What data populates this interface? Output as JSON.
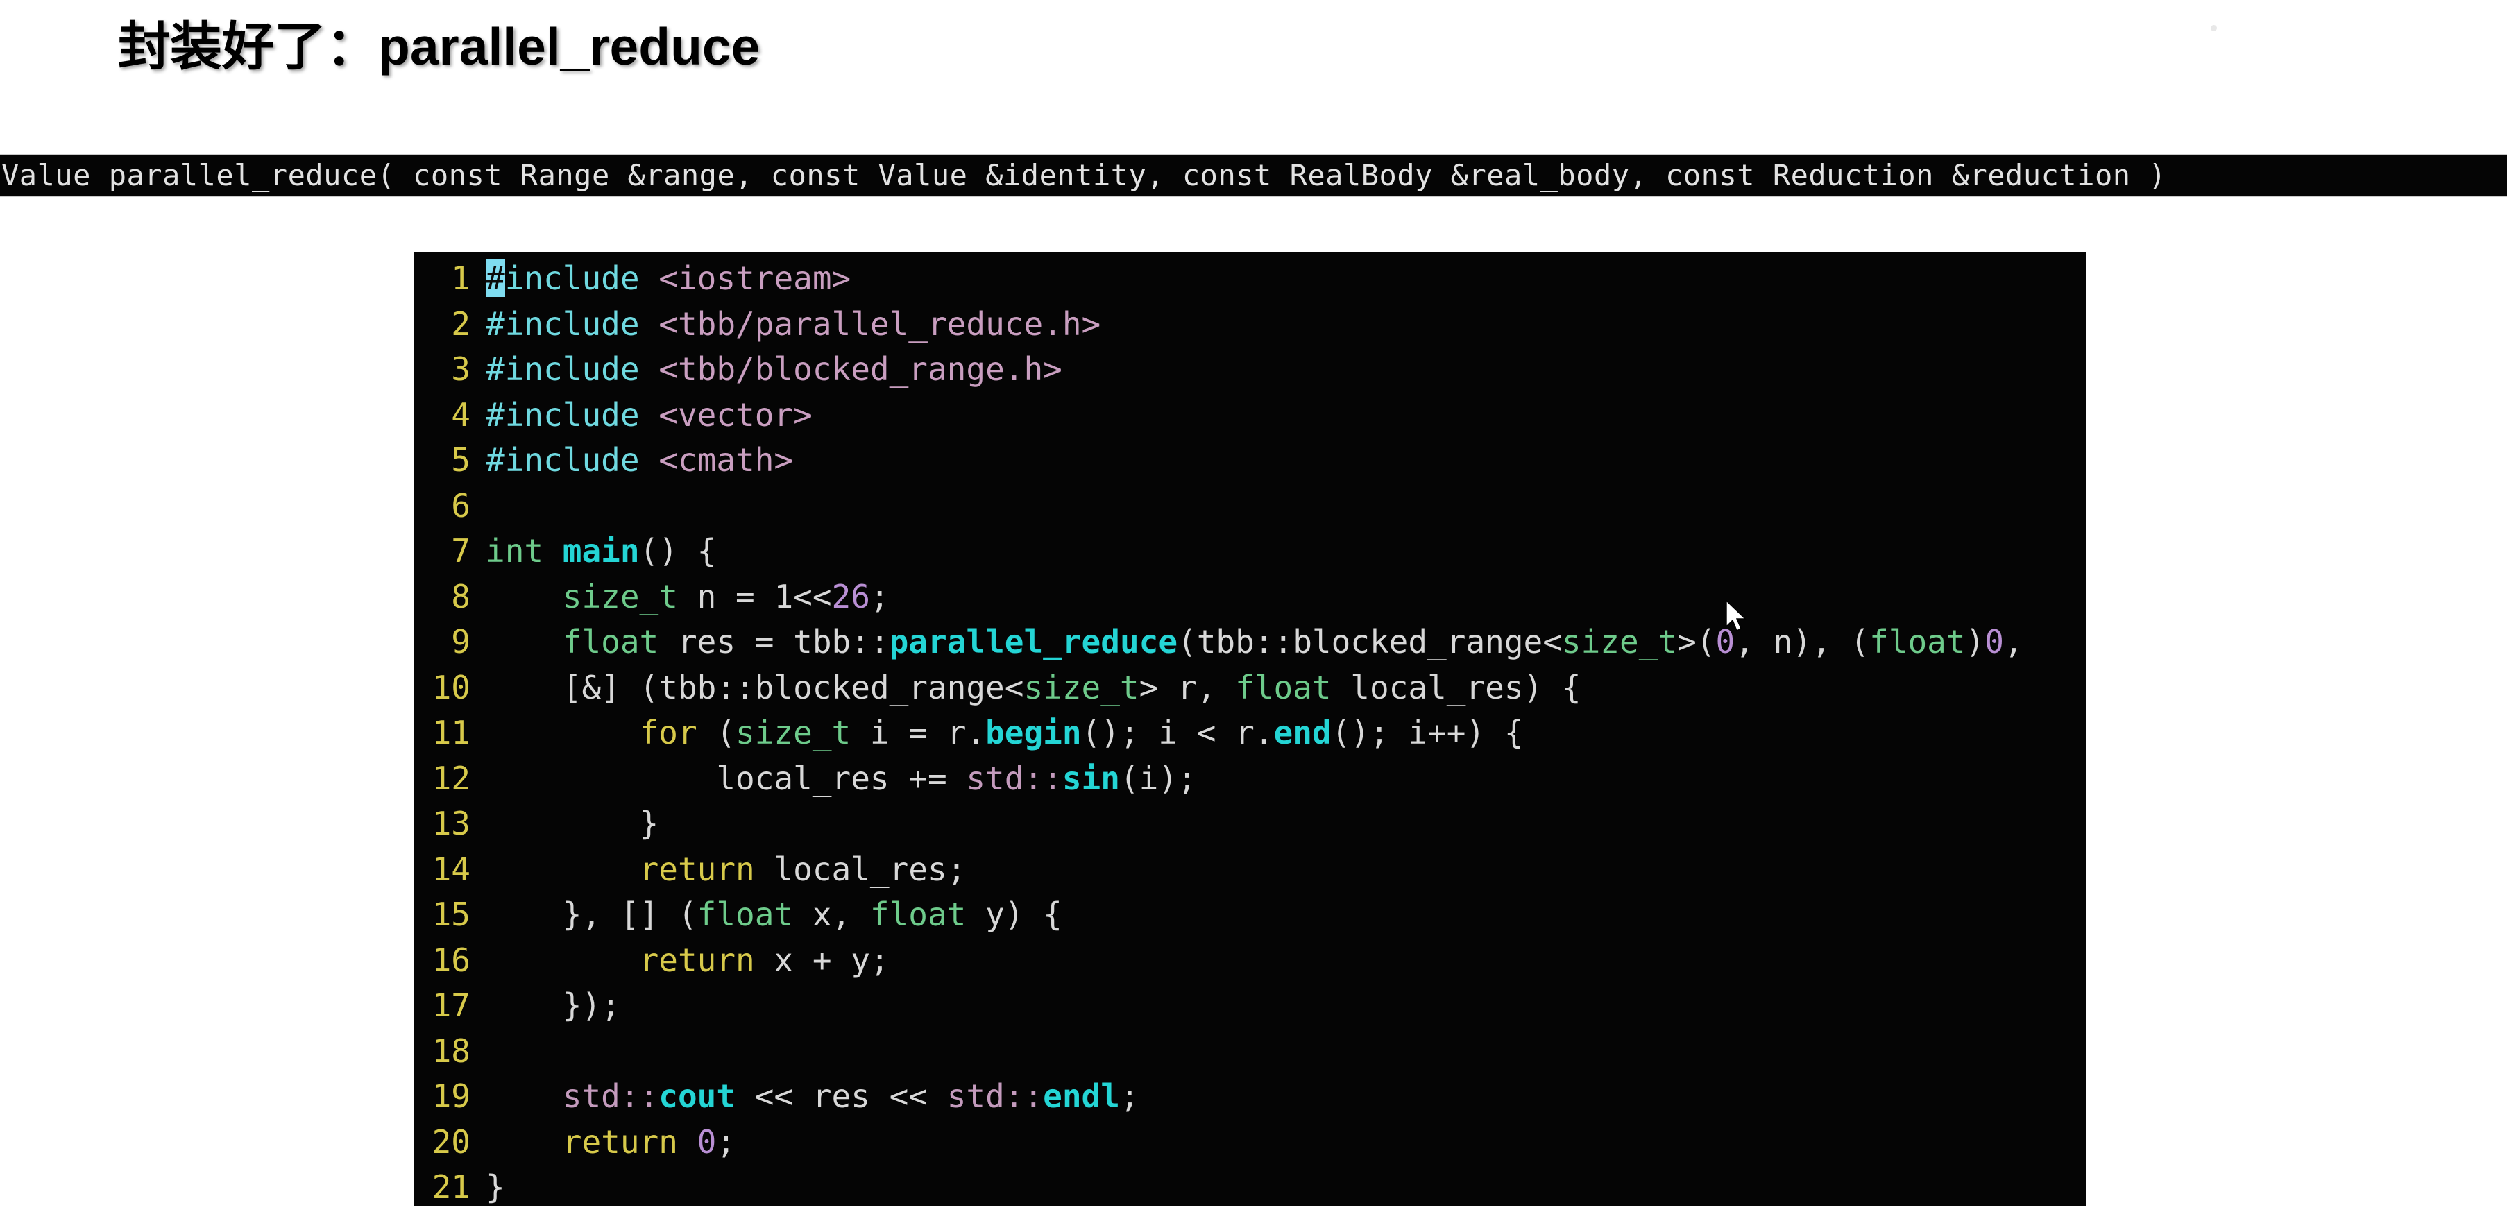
{
  "slide": {
    "title_cjk": "封装好了：",
    "title_latin": "parallel_reduce"
  },
  "signature": {
    "text": "Value parallel_reduce( const Range &range, const Value &identity, const RealBody &real_body, const Reduction &reduction )"
  },
  "code": {
    "language": "cpp",
    "line_numbers": [
      "1",
      "2",
      "3",
      "4",
      "5",
      "6",
      "7",
      "8",
      "9",
      "10",
      "11",
      "12",
      "13",
      "14",
      "15",
      "16",
      "17",
      "18",
      "19",
      "20",
      "21"
    ],
    "lines": [
      "#include <iostream>",
      "#include <tbb/parallel_reduce.h>",
      "#include <tbb/blocked_range.h>",
      "#include <vector>",
      "#include <cmath>",
      "",
      "int main() {",
      "    size_t n = 1<<26;",
      "    float res = tbb::parallel_reduce(tbb::blocked_range<size_t>(0, n), (float)0,",
      "    [&] (tbb::blocked_range<size_t> r, float local_res) {",
      "        for (size_t i = r.begin(); i < r.end(); i++) {",
      "            local_res += std::sin(i);",
      "        }",
      "        return local_res;",
      "    }, [] (float x, float y) {",
      "        return x + y;",
      "    });",
      "",
      "    std::cout << res << std::endl;",
      "    return 0;",
      "}"
    ],
    "tokens": {
      "l1": [
        {
          "t": "#",
          "c": "cursor"
        },
        {
          "t": "include",
          "c": "pre"
        },
        {
          "t": " ",
          "c": "plain"
        },
        {
          "t": "<iostream>",
          "c": "header"
        }
      ],
      "l2": [
        {
          "t": "#include",
          "c": "pre"
        },
        {
          "t": " ",
          "c": "plain"
        },
        {
          "t": "<tbb/parallel_reduce.h>",
          "c": "header"
        }
      ],
      "l3": [
        {
          "t": "#include",
          "c": "pre"
        },
        {
          "t": " ",
          "c": "plain"
        },
        {
          "t": "<tbb/blocked_range.h>",
          "c": "header"
        }
      ],
      "l4": [
        {
          "t": "#include",
          "c": "pre"
        },
        {
          "t": " ",
          "c": "plain"
        },
        {
          "t": "<vector>",
          "c": "header"
        }
      ],
      "l5": [
        {
          "t": "#include",
          "c": "pre"
        },
        {
          "t": " ",
          "c": "plain"
        },
        {
          "t": "<cmath>",
          "c": "header"
        }
      ],
      "l7": [
        {
          "t": "int",
          "c": "type"
        },
        {
          "t": " ",
          "c": "plain"
        },
        {
          "t": "main",
          "c": "fn"
        },
        {
          "t": "() {",
          "c": "plain"
        }
      ],
      "l8": [
        {
          "t": "    ",
          "c": "plain"
        },
        {
          "t": "size_t",
          "c": "type"
        },
        {
          "t": " n = ",
          "c": "plain"
        },
        {
          "t": "1",
          "c": "plain"
        },
        {
          "t": "<<",
          "c": "plain"
        },
        {
          "t": "26",
          "c": "num"
        },
        {
          "t": ";",
          "c": "plain"
        }
      ],
      "l9": [
        {
          "t": "    ",
          "c": "plain"
        },
        {
          "t": "float",
          "c": "type"
        },
        {
          "t": " res = tbb::",
          "c": "plain"
        },
        {
          "t": "parallel_reduce",
          "c": "fn"
        },
        {
          "t": "(tbb::blocked_range<",
          "c": "plain"
        },
        {
          "t": "size_t",
          "c": "type"
        },
        {
          "t": ">(",
          "c": "plain"
        },
        {
          "t": "0",
          "c": "num"
        },
        {
          "t": ", n), (",
          "c": "plain"
        },
        {
          "t": "float",
          "c": "type"
        },
        {
          "t": ")",
          "c": "plain"
        },
        {
          "t": "0",
          "c": "num"
        },
        {
          "t": ",",
          "c": "plain"
        }
      ],
      "l10": [
        {
          "t": "    [&] (tbb::blocked_range<",
          "c": "plain"
        },
        {
          "t": "size_t",
          "c": "type"
        },
        {
          "t": "> r, ",
          "c": "plain"
        },
        {
          "t": "float",
          "c": "type"
        },
        {
          "t": " local_res) {",
          "c": "plain"
        }
      ],
      "l11": [
        {
          "t": "        ",
          "c": "plain"
        },
        {
          "t": "for",
          "c": "kw"
        },
        {
          "t": " (",
          "c": "plain"
        },
        {
          "t": "size_t",
          "c": "type"
        },
        {
          "t": " i = r.",
          "c": "plain"
        },
        {
          "t": "begin",
          "c": "fn"
        },
        {
          "t": "(); i < r.",
          "c": "plain"
        },
        {
          "t": "end",
          "c": "fn"
        },
        {
          "t": "(); i++) {",
          "c": "plain"
        }
      ],
      "l12": [
        {
          "t": "            local_res += ",
          "c": "plain"
        },
        {
          "t": "std::",
          "c": "ns"
        },
        {
          "t": "sin",
          "c": "fn"
        },
        {
          "t": "(i);",
          "c": "plain"
        }
      ],
      "l13": [
        {
          "t": "        }",
          "c": "plain"
        }
      ],
      "l14": [
        {
          "t": "        ",
          "c": "plain"
        },
        {
          "t": "return",
          "c": "kw"
        },
        {
          "t": " local_res;",
          "c": "plain"
        }
      ],
      "l15": [
        {
          "t": "    }, [] (",
          "c": "plain"
        },
        {
          "t": "float",
          "c": "type"
        },
        {
          "t": " x, ",
          "c": "plain"
        },
        {
          "t": "float",
          "c": "type"
        },
        {
          "t": " y) {",
          "c": "plain"
        }
      ],
      "l16": [
        {
          "t": "        ",
          "c": "plain"
        },
        {
          "t": "return",
          "c": "kw"
        },
        {
          "t": " x + y;",
          "c": "plain"
        }
      ],
      "l17": [
        {
          "t": "    });",
          "c": "plain"
        }
      ],
      "l19": [
        {
          "t": "    ",
          "c": "plain"
        },
        {
          "t": "std::",
          "c": "ns"
        },
        {
          "t": "cout",
          "c": "fn"
        },
        {
          "t": " << res << ",
          "c": "plain"
        },
        {
          "t": "std::",
          "c": "ns"
        },
        {
          "t": "endl",
          "c": "fn"
        },
        {
          "t": ";",
          "c": "plain"
        }
      ],
      "l20": [
        {
          "t": "    ",
          "c": "plain"
        },
        {
          "t": "return",
          "c": "kw"
        },
        {
          "t": " ",
          "c": "plain"
        },
        {
          "t": "0",
          "c": "num"
        },
        {
          "t": ";",
          "c": "plain"
        }
      ],
      "l21": [
        {
          "t": "}",
          "c": "plain"
        }
      ]
    }
  },
  "colors": {
    "page_background": "#ffffff",
    "code_background": "#050505",
    "title_text": "#000000",
    "signature_text": "#e2e2e2",
    "signature_background": "#050505",
    "line_number": "#d7c94a",
    "token_plain": "#d8d8d8",
    "token_preprocessor": "#6fd9e0",
    "token_header_path": "#c99ec0",
    "token_type": "#6ecb8b",
    "token_keyword": "#d7c94a",
    "token_function": "#24d5d5",
    "token_namespace": "#c49bbd",
    "token_number": "#b98fd4",
    "cursor_highlight": "#7fdcf0"
  }
}
